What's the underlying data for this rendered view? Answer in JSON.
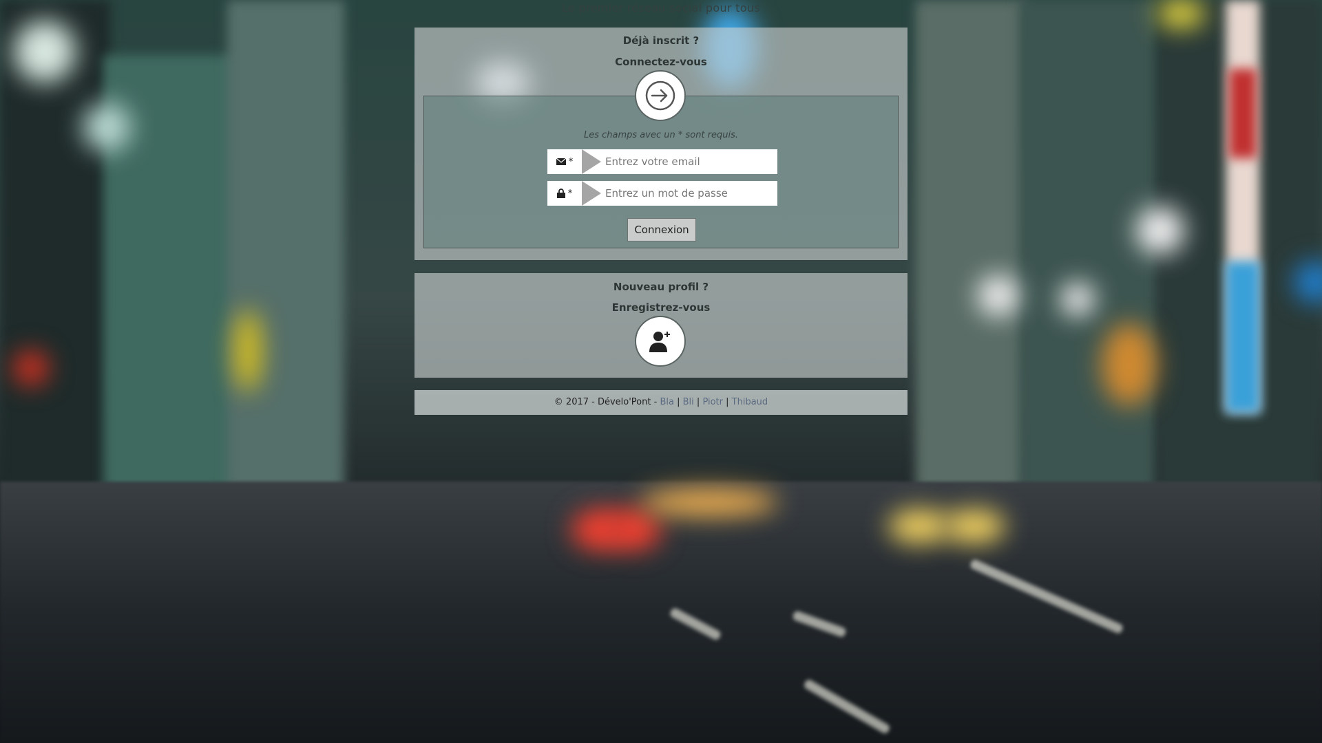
{
  "tagline": "Le premier réseau social pour tous",
  "login": {
    "heading": "Déjà inscrit ?",
    "subheading": "Connectez-vous",
    "icon": "login-arrow-icon",
    "required_note": "Les champs avec un * sont requis.",
    "email": {
      "icon": "envelope-icon",
      "marker": "*",
      "placeholder": "Entrez votre email",
      "value": ""
    },
    "password": {
      "icon": "lock-icon",
      "marker": "*",
      "placeholder": "Entrez un mot de passe",
      "value": ""
    },
    "submit_label": "Connexion"
  },
  "register": {
    "heading": "Nouveau profil ?",
    "subheading": "Enregistrez-vous",
    "icon": "add-user-icon"
  },
  "footer": {
    "prefix": "© 2017 - Dévelo'Pont -",
    "links": [
      "Bla",
      "Bli",
      "Piotr",
      "Thibaud"
    ],
    "separator": "|"
  },
  "colors": {
    "link": "#5a6a80",
    "card_bg": "rgba(205,210,210,0.62)",
    "form_bg": "rgba(80,118,112,0.45)"
  }
}
